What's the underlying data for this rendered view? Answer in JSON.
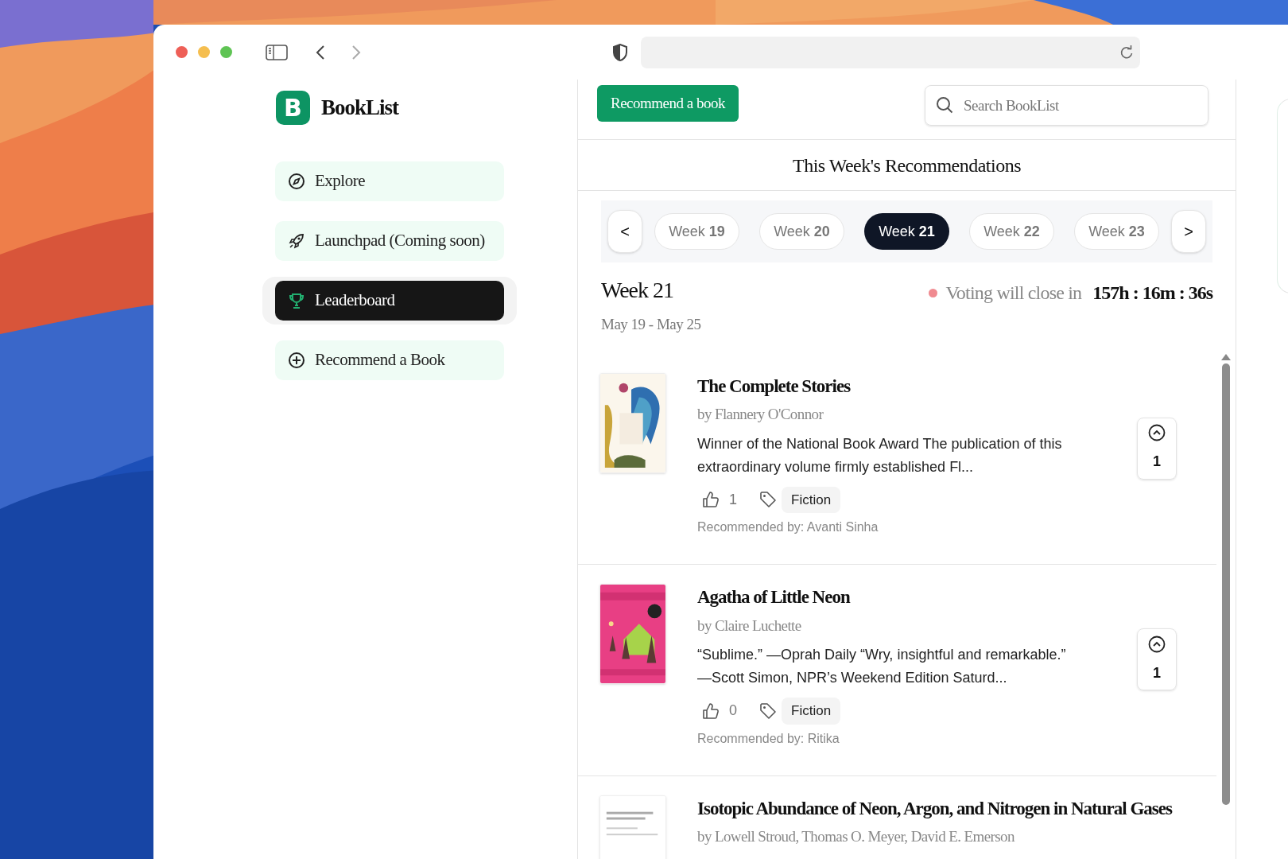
{
  "sidebar": {
    "logo_letter": "B",
    "logo_text": "BookList",
    "items": [
      {
        "label": "Explore",
        "selected": false
      },
      {
        "label": "Launchpad (Coming soon)",
        "selected": false
      },
      {
        "label": "Leaderboard",
        "selected": true
      },
      {
        "label": "Recommend a Book",
        "selected": false
      }
    ]
  },
  "header": {
    "button": "Recommend a book",
    "search_placeholder": "Search BookList"
  },
  "section_title": "This Week's Recommendations",
  "week_nav": {
    "prev": "<",
    "next": ">",
    "weeks": [
      {
        "label": "Week **19**",
        "selected": false
      },
      {
        "label": "Week **20**",
        "selected": false
      },
      {
        "label": "Week **21**",
        "selected": true
      },
      {
        "label": "Week **22**",
        "selected": false
      },
      {
        "label": "Week **23**",
        "selected": false
      }
    ]
  },
  "week_info": {
    "title": "Week 21",
    "dates": "May 19 - May 25",
    "voting_label": "Voting will close in",
    "countdown": "157h : 16m : 36s"
  },
  "books": [
    {
      "title": "The Complete Stories",
      "author": "by Flannery O'Connor",
      "description": "Winner of the National Book Award The publication of this extraordinary volume firmly established Fl...",
      "likes": "1",
      "tag": "Fiction",
      "recommended_by": "Recommended by: Avanti Sinha",
      "votes": "1"
    },
    {
      "title": "Agatha of Little Neon",
      "author": "by Claire Luchette",
      "description": "“Sublime.” —Oprah Daily “Wry, insightful and remarkable.” —Scott Simon, NPR’s Weekend Edition Saturd...",
      "likes": "0",
      "tag": "Fiction",
      "recommended_by": "Recommended by: Ritika",
      "votes": "1"
    },
    {
      "title": "Isotopic Abundance of Neon, Argon, and Nitrogen in Natural Gases",
      "author": "by Lowell Stroud, Thomas O. Meyer, David E. Emerson"
    }
  ]
}
